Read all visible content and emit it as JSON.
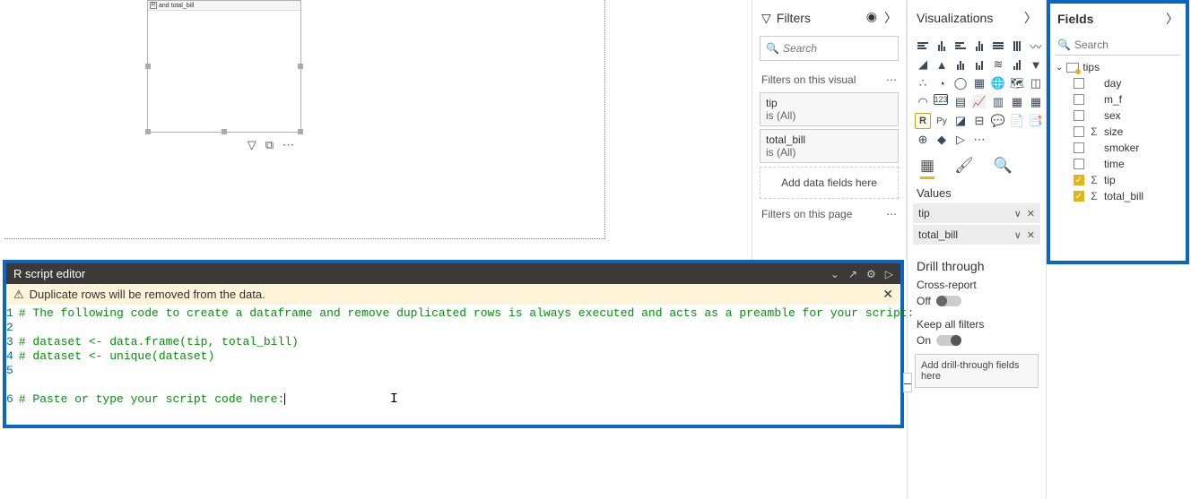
{
  "canvas": {
    "visual_header": "and total_bill"
  },
  "filters": {
    "title": "Filters",
    "search_placeholder": "Search",
    "on_visual_label": "Filters on this visual",
    "cards": [
      {
        "name": "tip",
        "state": "is (All)"
      },
      {
        "name": "total_bill",
        "state": "is (All)"
      }
    ],
    "add_fields": "Add data fields here",
    "on_page_label": "Filters on this page"
  },
  "viz": {
    "title": "Visualizations",
    "tabs": {
      "values": "Values"
    },
    "wells": [
      {
        "name": "tip"
      },
      {
        "name": "total_bill"
      }
    ],
    "drill": {
      "title": "Drill through",
      "cross_report": "Cross-report",
      "cross_report_state": "Off",
      "keep_filters": "Keep all filters",
      "keep_filters_state": "On",
      "hint": "Add drill-through fields here"
    }
  },
  "fields": {
    "title": "Fields",
    "search_placeholder": "Search",
    "table": "tips",
    "items": [
      {
        "name": "day",
        "checked": false,
        "numeric": false
      },
      {
        "name": "m_f",
        "checked": false,
        "numeric": false
      },
      {
        "name": "sex",
        "checked": false,
        "numeric": false
      },
      {
        "name": "size",
        "checked": false,
        "numeric": true
      },
      {
        "name": "smoker",
        "checked": false,
        "numeric": false
      },
      {
        "name": "time",
        "checked": false,
        "numeric": false
      },
      {
        "name": "tip",
        "checked": true,
        "numeric": true
      },
      {
        "name": "total_bill",
        "checked": true,
        "numeric": true
      }
    ]
  },
  "editor": {
    "title": "R script editor",
    "warning": "Duplicate rows will be removed from the data.",
    "gutter": "1\n2\n3\n4\n5\n\n6",
    "lines": "# The following code to create a dataframe and remove duplicated rows is always executed and acts as a preamble for your script:\n\n# dataset <- data.frame(tip, total_bill)\n# dataset <- unique(dataset)\n\n\n# Paste or type your script code here:"
  }
}
